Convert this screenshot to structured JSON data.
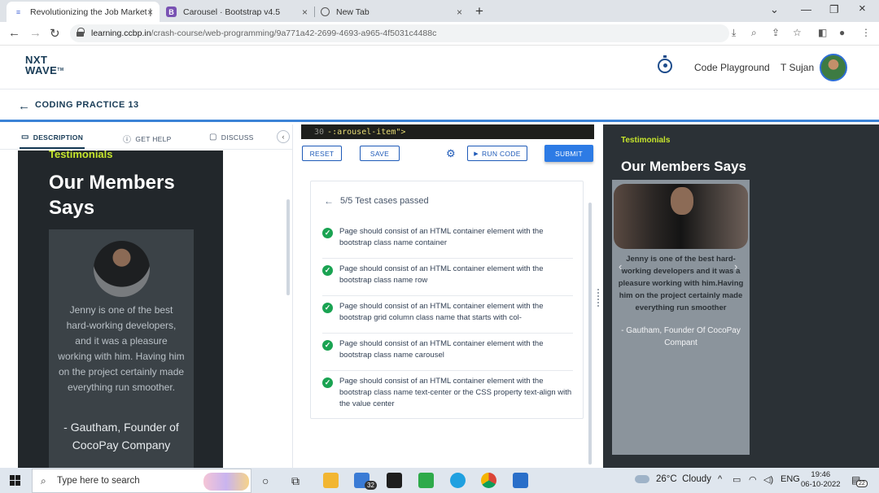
{
  "browser": {
    "tabs": [
      {
        "title": "Revolutionizing the Job Market |",
        "icon": "ccbp-icon",
        "active": true
      },
      {
        "title": "Carousel · Bootstrap v4.5",
        "icon": "bootstrap-icon",
        "active": false
      },
      {
        "title": "New Tab",
        "icon": "chrome-icon",
        "active": false
      }
    ],
    "url_host": "learning.ccbp.in",
    "url_path": "/crash-course/web-programming/9a771a42-2699-4693-a965-4f5031c4488c"
  },
  "header": {
    "logo_line1": "NXT",
    "logo_line2": "WAVE",
    "logo_tm": "TM",
    "playground_label": "Code Playground",
    "user_name": "T Sujan"
  },
  "practice": {
    "title": "CODING PRACTICE 13"
  },
  "left_panel": {
    "tabs": [
      {
        "label": "DESCRIPTION",
        "icon": "description-icon"
      },
      {
        "label": "GET HELP",
        "icon": "help-icon"
      },
      {
        "label": "DISCUSS",
        "icon": "chat-icon"
      }
    ],
    "preview": {
      "eyebrow": "Testimonials",
      "heading": "Our Members Says",
      "quote": "Jenny is one of the best hard-working developers, and it was a pleasure working with him. Having him on the project certainly made everything run smoother.",
      "author": "- Gautham, Founder of CocoPay Company"
    }
  },
  "editor": {
    "line_number": "30",
    "code": "-:arousel-item\">",
    "reset_label": "RESET",
    "save_label": "SAVE",
    "run_label": "RUN CODE",
    "submit_label": "SUBMIT"
  },
  "results": {
    "summary": "5/5 Test cases passed",
    "tests": [
      "Page should consist of an HTML container element with the bootstrap class name container",
      "Page should consist of an HTML container element with the bootstrap class name row",
      "Page should consist of an HTML container element with the bootstrap grid column class name that starts with col-",
      "Page should consist of an HTML container element with the bootstrap class name carousel",
      "Page should consist of an HTML container element with the bootstrap class name text-center or the CSS property text-align with the value center"
    ]
  },
  "output": {
    "eyebrow": "Testimonials",
    "heading": "Our Members Says",
    "quote": "Jenny is one of the best hard-working developers and it was a pleasure working with him.Having him on the project certainly made everything run smoother",
    "author": "- Gautham, Founder Of CocoPay Compant"
  },
  "taskbar": {
    "search_placeholder": "Type here to search",
    "mail_badge": "32",
    "temperature": "26°C",
    "weather": "Cloudy",
    "language": "ENG",
    "time": "19:46",
    "date": "06-10-2022",
    "notification_count": "22"
  },
  "colors": {
    "accent": "#c6e52c",
    "brand": "#183b56",
    "primary": "#2d7be5",
    "pass": "#1aa352"
  }
}
